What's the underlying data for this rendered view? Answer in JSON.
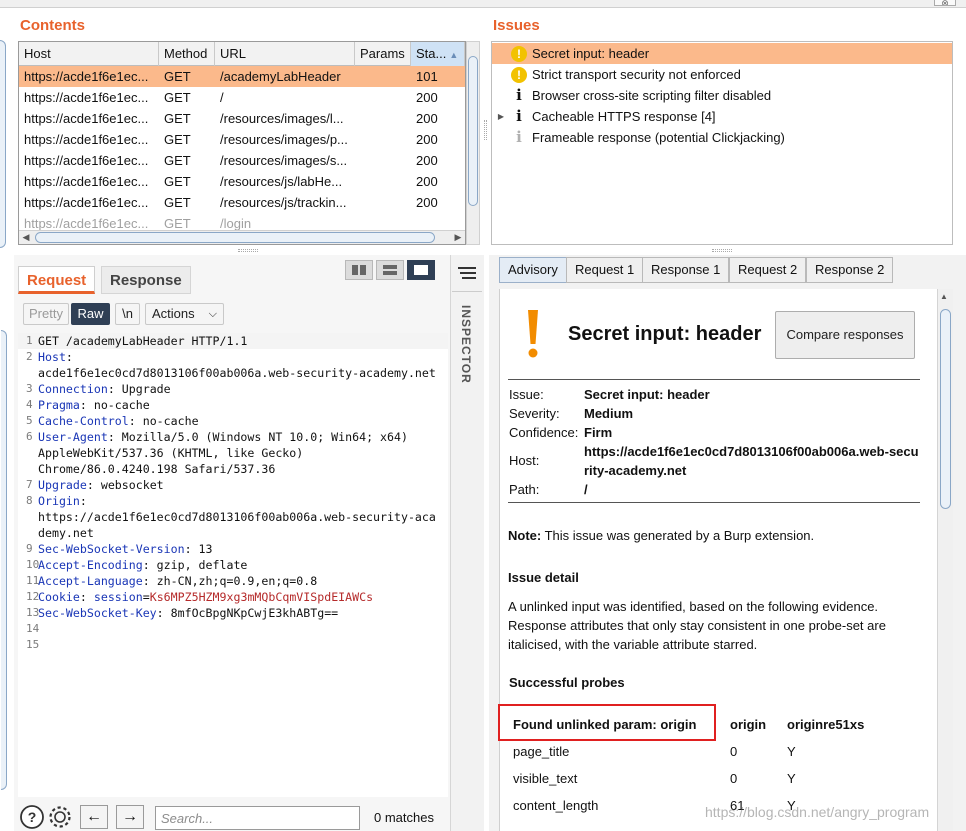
{
  "contents": {
    "title": "Contents",
    "columns": [
      "Host",
      "Method",
      "URL",
      "Params",
      "Sta..."
    ],
    "rows": [
      {
        "host": "https://acde1f6e1ec...",
        "method": "GET",
        "url": "/academyLabHeader",
        "params": "",
        "status": "101"
      },
      {
        "host": "https://acde1f6e1ec...",
        "method": "GET",
        "url": "/",
        "params": "",
        "status": "200"
      },
      {
        "host": "https://acde1f6e1ec...",
        "method": "GET",
        "url": "/resources/images/l...",
        "params": "",
        "status": "200"
      },
      {
        "host": "https://acde1f6e1ec...",
        "method": "GET",
        "url": "/resources/images/p...",
        "params": "",
        "status": "200"
      },
      {
        "host": "https://acde1f6e1ec...",
        "method": "GET",
        "url": "/resources/images/s...",
        "params": "",
        "status": "200"
      },
      {
        "host": "https://acde1f6e1ec...",
        "method": "GET",
        "url": "/resources/js/labHe...",
        "params": "",
        "status": "200"
      },
      {
        "host": "https://acde1f6e1ec...",
        "method": "GET",
        "url": "/resources/js/trackin...",
        "params": "",
        "status": "200"
      },
      {
        "host": "https://acde1f6e1ec...",
        "method": "GET",
        "url": "/login",
        "params": "",
        "status": ""
      }
    ]
  },
  "issues": {
    "title": "Issues",
    "items": [
      {
        "label": "Secret input: header",
        "icon": "warning-icon"
      },
      {
        "label": "Strict transport security not enforced",
        "icon": "warning-icon"
      },
      {
        "label": "Browser cross-site scripting filter disabled",
        "icon": "info-icon"
      },
      {
        "label": "Cacheable HTTPS response [4]",
        "icon": "info-icon"
      },
      {
        "label": "Frameable response (potential Clickjacking)",
        "icon": "info-icon"
      }
    ]
  },
  "request_panel": {
    "tab_request": "Request",
    "tab_response": "Response",
    "btn_pretty": "Pretty",
    "btn_raw": "Raw",
    "btn_newline": "\\n",
    "btn_actions": "Actions",
    "inspector_label": "INSPECTOR",
    "lines": [
      {
        "n": "1",
        "parts": [
          {
            "t": "GET /academyLabHeader HTTP/1.1",
            "c": ""
          }
        ]
      },
      {
        "n": "2",
        "parts": [
          {
            "t": "Host",
            "c": "hk"
          },
          {
            "t": ":",
            "c": ""
          }
        ]
      },
      {
        "n": "",
        "parts": [
          {
            "t": "acde1f6e1ec0cd7d8013106f00ab006a.web-security-academy.net",
            "c": ""
          }
        ]
      },
      {
        "n": "3",
        "parts": [
          {
            "t": "Connection",
            "c": "hk"
          },
          {
            "t": ": Upgrade",
            "c": ""
          }
        ]
      },
      {
        "n": "4",
        "parts": [
          {
            "t": "Pragma",
            "c": "hk"
          },
          {
            "t": ": no-cache",
            "c": ""
          }
        ]
      },
      {
        "n": "5",
        "parts": [
          {
            "t": "Cache-Control",
            "c": "hk"
          },
          {
            "t": ": no-cache",
            "c": ""
          }
        ]
      },
      {
        "n": "6",
        "parts": [
          {
            "t": "User-Agent",
            "c": "hk"
          },
          {
            "t": ": Mozilla/5.0 (Windows NT 10.0; Win64; x64)",
            "c": ""
          }
        ]
      },
      {
        "n": "",
        "parts": [
          {
            "t": "AppleWebKit/537.36 (KHTML, like Gecko)",
            "c": ""
          }
        ]
      },
      {
        "n": "",
        "parts": [
          {
            "t": "Chrome/86.0.4240.198 Safari/537.36",
            "c": ""
          }
        ]
      },
      {
        "n": "7",
        "parts": [
          {
            "t": "Upgrade",
            "c": "hk"
          },
          {
            "t": ": websocket",
            "c": ""
          }
        ]
      },
      {
        "n": "8",
        "parts": [
          {
            "t": "Origin",
            "c": "hk"
          },
          {
            "t": ":",
            "c": ""
          }
        ]
      },
      {
        "n": "",
        "parts": [
          {
            "t": "https://acde1f6e1ec0cd7d8013106f00ab006a.web-security-aca",
            "c": ""
          }
        ]
      },
      {
        "n": "",
        "parts": [
          {
            "t": "demy.net",
            "c": ""
          }
        ]
      },
      {
        "n": "9",
        "parts": [
          {
            "t": "Sec-WebSocket-Version",
            "c": "hk"
          },
          {
            "t": ": 13",
            "c": ""
          }
        ]
      },
      {
        "n": "10",
        "parts": [
          {
            "t": "Accept-Encoding",
            "c": "hk"
          },
          {
            "t": ": gzip, deflate",
            "c": ""
          }
        ]
      },
      {
        "n": "11",
        "parts": [
          {
            "t": "Accept-Language",
            "c": "hk"
          },
          {
            "t": ": zh-CN,zh;q=0.9,en;q=0.8",
            "c": ""
          }
        ]
      },
      {
        "n": "12",
        "parts": [
          {
            "t": "Cookie",
            "c": "hk"
          },
          {
            "t": ": ",
            "c": ""
          },
          {
            "t": "session",
            "c": "hk"
          },
          {
            "t": "=",
            "c": ""
          },
          {
            "t": "Ks6MPZ5HZM9xg3mMQbCqmVISpdEIAWCs",
            "c": "ck"
          }
        ]
      },
      {
        "n": "13",
        "parts": [
          {
            "t": "Sec-WebSocket-Key",
            "c": "hk"
          },
          {
            "t": ": 8mfOcBpgNKpCwjE3khABTg==",
            "c": ""
          }
        ]
      },
      {
        "n": "14",
        "parts": []
      },
      {
        "n": "15",
        "parts": []
      }
    ]
  },
  "search": {
    "placeholder": "Search...",
    "matches": "0 matches"
  },
  "advisory_tabs": [
    "Advisory",
    "Request 1",
    "Response 1",
    "Request 2",
    "Response 2"
  ],
  "advisory": {
    "title": "Secret input: header",
    "compare_button": "Compare responses",
    "issue_label": "Issue:",
    "issue_value": "Secret input: header",
    "severity_label": "Severity:",
    "severity_value": "Medium",
    "confidence_label": "Confidence:",
    "confidence_value": "Firm",
    "host_label": "Host:",
    "host_value_1": "https://acde1f6e1ec0cd7d8013106f00ab006a.web-secu",
    "host_value_2": "rity-academy.net",
    "path_label": "Path:",
    "path_value": "/",
    "note_bold": "Note:",
    "note_text": " This issue was generated by a Burp extension.",
    "detail_head": "Issue detail",
    "detail_1": "A unlinked input was identified, based on the following evidence.",
    "detail_2": "Response attributes that only stay consistent in one probe-set are",
    "detail_3": "italicised, with the variable attribute starred.",
    "probes_head": "Successful probes",
    "probe_header": [
      "Found unlinked param: origin",
      "origin",
      "originre51xs"
    ],
    "probe_rows": [
      [
        "page_title",
        "0",
        "Y"
      ],
      [
        "visible_text",
        "0",
        "Y"
      ],
      [
        "content_length",
        "61",
        "Y"
      ]
    ],
    "highlight_color": "#e02020"
  },
  "watermark": "https://blog.csdn.net/angry_program"
}
